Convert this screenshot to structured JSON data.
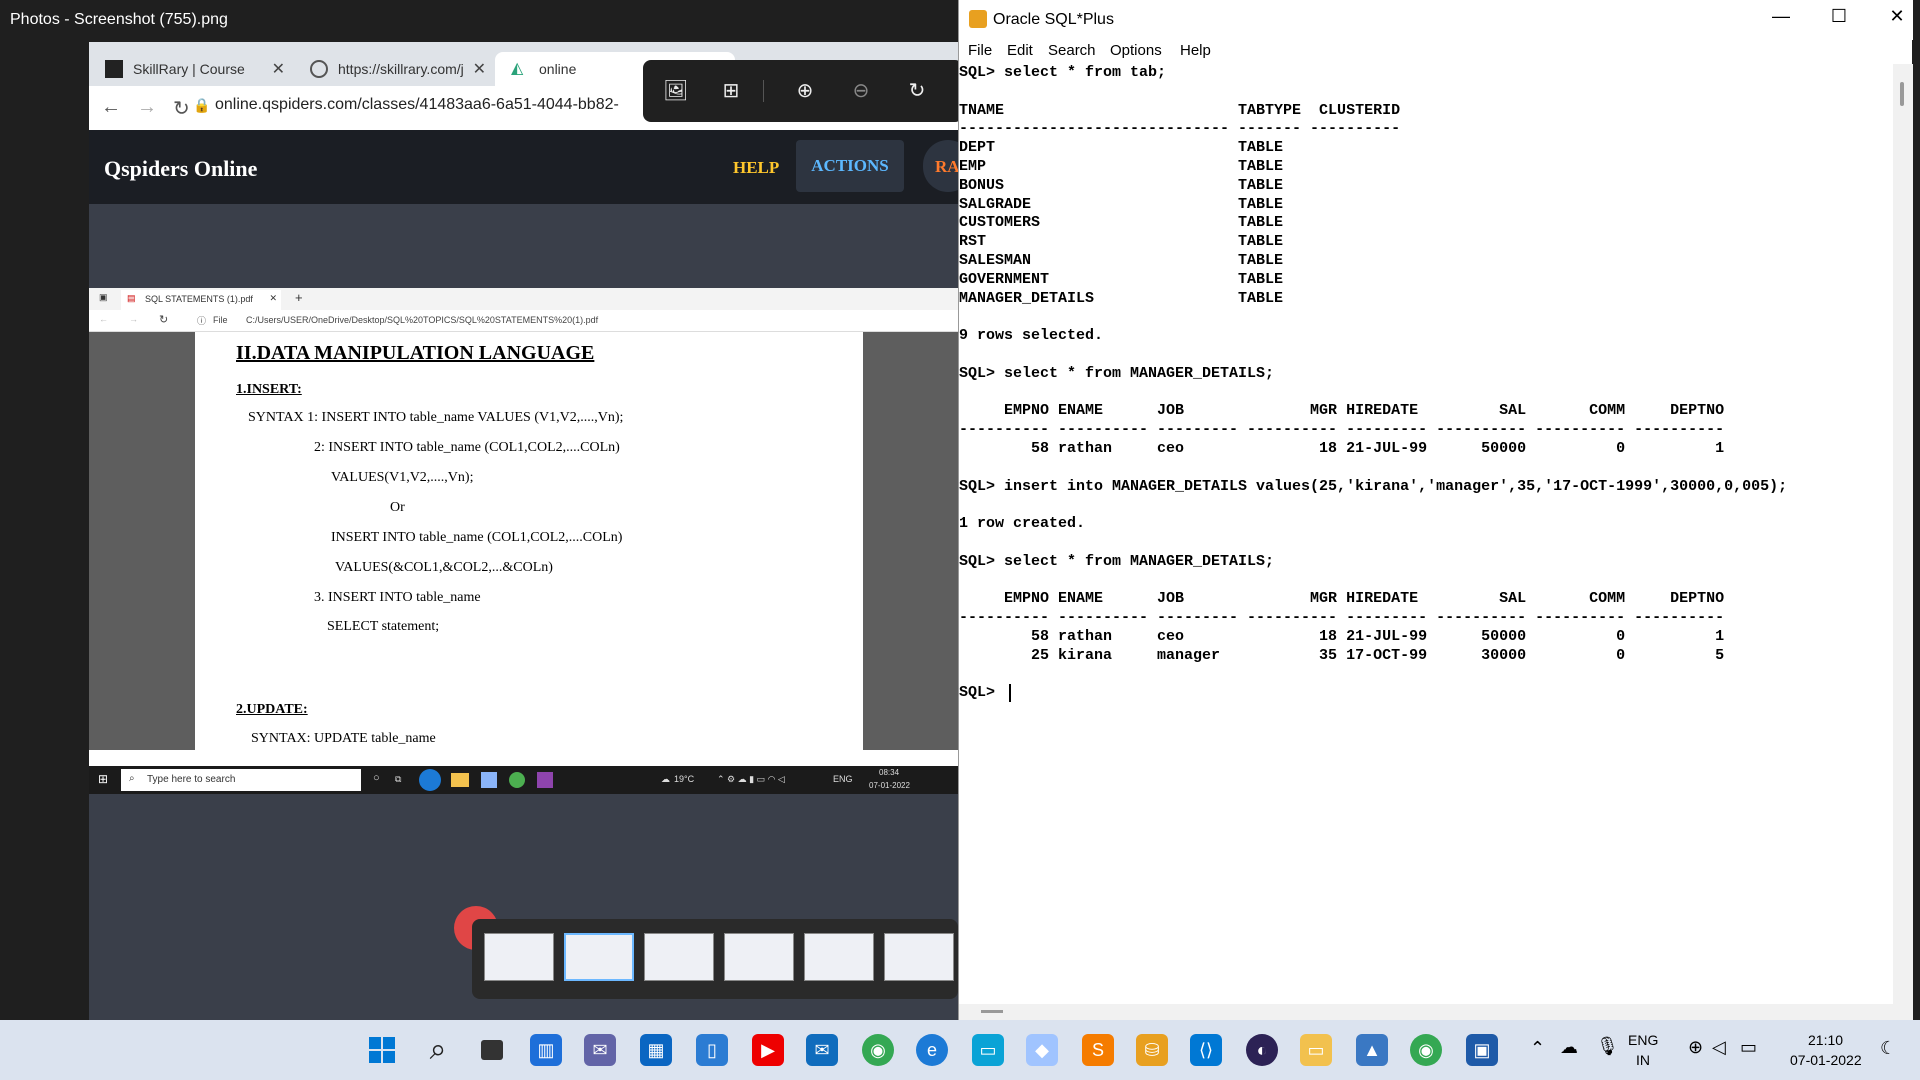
{
  "photos": {
    "window_title": "Photos - Screenshot (755).png"
  },
  "browser": {
    "tabs": [
      {
        "label": "SkillRary | Course"
      },
      {
        "label": "https://skillrary.com/j"
      },
      {
        "label": "online"
      }
    ],
    "url": "online.qspiders.com/classes/41483aa6-6a51-4044-bb82-",
    "site_title": "Qspiders Online",
    "nav": {
      "help": "HELP",
      "actions": "ACTIONS",
      "more": "RA"
    }
  },
  "shared_screen": {
    "pdf_tab": "SQL STATEMENTS (1).pdf",
    "pdf_file_label": "File",
    "pdf_path": "C:/Users/USER/OneDrive/Desktop/SQL%20TOPICS/SQL%20STATEMENTS%20(1).pdf",
    "heading": "II.DATA MANIPULATION LANGUAGE",
    "lines": [
      "1.INSERT:",
      "SYNTAX 1: INSERT  INTO  table_name  VALUES (V1,V2,....,Vn);",
      "2: INSERT  INTO  table_name (COL1,COL2,....COLn)",
      "VALUES(V1,V2,....,Vn);",
      "Or",
      "INSERT  INTO  table_name (COL1,COL2,....COLn)",
      "VALUES(&COL1,&COL2,...&COLn)",
      "3. INSERT INTO table_name",
      "SELECT statement;",
      "2.UPDATE:",
      "SYNTAX:  UPDATE table_name"
    ],
    "taskbar": {
      "search_placeholder": "Type here to search",
      "weather": "19°C",
      "lang": "ENG",
      "time": "08:34",
      "date": "07-01-2022"
    }
  },
  "sqlplus": {
    "title": "Oracle SQL*Plus",
    "menu": [
      "File",
      "Edit",
      "Search",
      "Options",
      "Help"
    ],
    "console_lines": [
      "SQL> select * from tab;",
      "",
      "TNAME                          TABTYPE  CLUSTERID",
      "------------------------------ ------- ----------",
      "DEPT                           TABLE",
      "EMP                            TABLE",
      "BONUS                          TABLE",
      "SALGRADE                       TABLE",
      "CUSTOMERS                      TABLE",
      "RST                            TABLE",
      "SALESMAN                       TABLE",
      "GOVERNMENT                     TABLE",
      "MANAGER_DETAILS                TABLE",
      "",
      "9 rows selected.",
      "",
      "SQL> select * from MANAGER_DETAILS;",
      "",
      "     EMPNO ENAME      JOB              MGR HIREDATE         SAL       COMM     DEPTNO",
      "---------- ---------- --------- ---------- --------- ---------- ---------- ----------",
      "        58 rathan     ceo               18 21-JUL-99      50000          0          1",
      "",
      "SQL> insert into MANAGER_DETAILS values(25,'kirana','manager',35,'17-OCT-1999',30000,0,005);",
      "",
      "1 row created.",
      "",
      "SQL> select * from MANAGER_DETAILS;",
      "",
      "     EMPNO ENAME      JOB              MGR HIREDATE         SAL       COMM     DEPTNO",
      "---------- ---------- --------- ---------- --------- ---------- ---------- ----------",
      "        58 rathan     ceo               18 21-JUL-99      50000          0          1",
      "        25 kirana     manager           35 17-OCT-99      30000          0          5",
      "",
      "SQL> "
    ]
  },
  "taskbar": {
    "lang": "ENG",
    "region": "IN",
    "time": "21:10",
    "date": "07-01-2022"
  }
}
